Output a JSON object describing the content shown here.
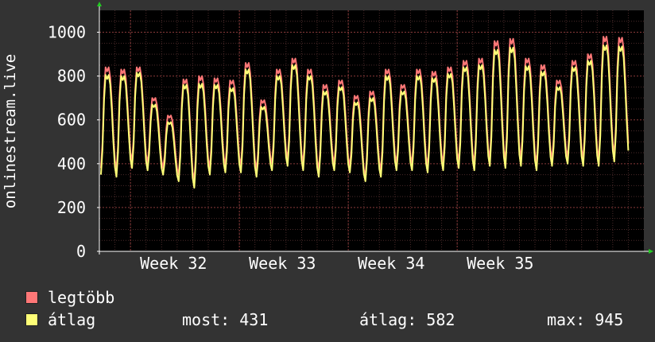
{
  "chart_data": {
    "type": "line",
    "ylabel": "onlinestream.live",
    "ylim": [
      0,
      1100
    ],
    "yticks": [
      0,
      200,
      400,
      600,
      800,
      1000
    ],
    "x_tick_labels": [
      "Week 32",
      "Week 33",
      "Week 34",
      "Week 35"
    ],
    "x_range_days": [
      0,
      35
    ],
    "x_tick_days": [
      2,
      9,
      16,
      23
    ],
    "grid": true,
    "legend_placement": "bottom",
    "series": [
      {
        "name": "legtöbb",
        "color": "#ff7777",
        "daily_peaks": [
          840,
          830,
          840,
          700,
          620,
          785,
          800,
          790,
          780,
          860,
          690,
          830,
          880,
          830,
          760,
          780,
          710,
          730,
          830,
          760,
          830,
          820,
          840,
          870,
          880,
          960,
          970,
          880,
          850,
          780,
          870,
          900,
          980,
          975
        ],
        "daily_troughs": [
          380,
          370,
          410,
          400,
          380,
          350,
          320,
          380,
          390,
          390,
          370,
          400,
          420,
          400,
          370,
          400,
          390,
          340,
          370,
          400,
          400,
          390,
          400,
          410,
          400,
          420,
          410,
          420,
          400,
          420,
          430,
          420,
          420,
          440
        ]
      },
      {
        "name": "átlag",
        "color": "#ffff77",
        "daily_peaks": [
          805,
          800,
          815,
          670,
          590,
          760,
          765,
          760,
          745,
          830,
          660,
          800,
          850,
          800,
          730,
          750,
          680,
          700,
          800,
          730,
          800,
          790,
          810,
          840,
          850,
          920,
          930,
          845,
          820,
          750,
          840,
          870,
          940,
          935
        ],
        "daily_troughs": [
          350,
          340,
          380,
          370,
          350,
          320,
          290,
          350,
          360,
          360,
          340,
          370,
          390,
          370,
          340,
          370,
          360,
          320,
          340,
          370,
          370,
          360,
          370,
          380,
          370,
          390,
          380,
          390,
          370,
          390,
          400,
          390,
          390,
          410
        ]
      }
    ]
  },
  "legend": {
    "max_label": "legtöbb",
    "avg_label": "átlag",
    "max_color": "#ff7777",
    "avg_color": "#ffff77"
  },
  "stats": {
    "now": "most: 431",
    "avg": "átlag: 582",
    "max": "max: 945"
  }
}
